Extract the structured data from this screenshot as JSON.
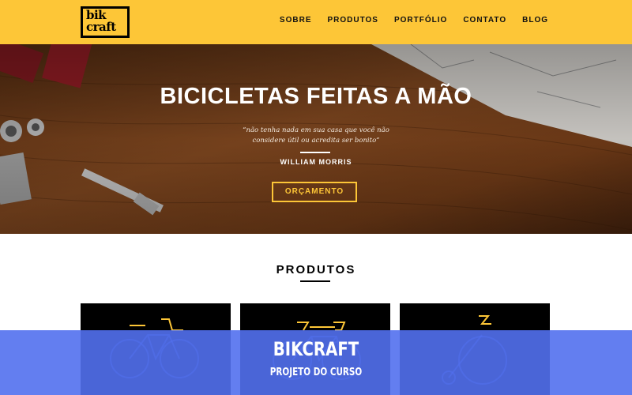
{
  "header": {
    "logo_text": "bik craft",
    "nav": [
      {
        "label": "SOBRE"
      },
      {
        "label": "PRODUTOS"
      },
      {
        "label": "PORTFÓLIO"
      },
      {
        "label": "CONTATO"
      },
      {
        "label": "BLOG"
      }
    ]
  },
  "hero": {
    "title": "BICICLETAS FEITAS A MÃO",
    "quote": "“não tenha nada em sua casa que você não considere útil ou acredita ser bonito”",
    "author": "WILLIAM MORRIS",
    "button_label": "ORÇAMENTO"
  },
  "products": {
    "title": "PRODUTOS",
    "cards": [
      {
        "icon": "bicycle-basket-icon"
      },
      {
        "icon": "bicycle-icon"
      },
      {
        "icon": "penny-farthing-icon"
      }
    ]
  },
  "banner": {
    "title": "BIKCRAFT",
    "subtitle": "PROJETO DO CURSO"
  },
  "colors": {
    "brand_yellow": "#fdc637",
    "banner_blue": "#5270ee",
    "black": "#000000"
  }
}
